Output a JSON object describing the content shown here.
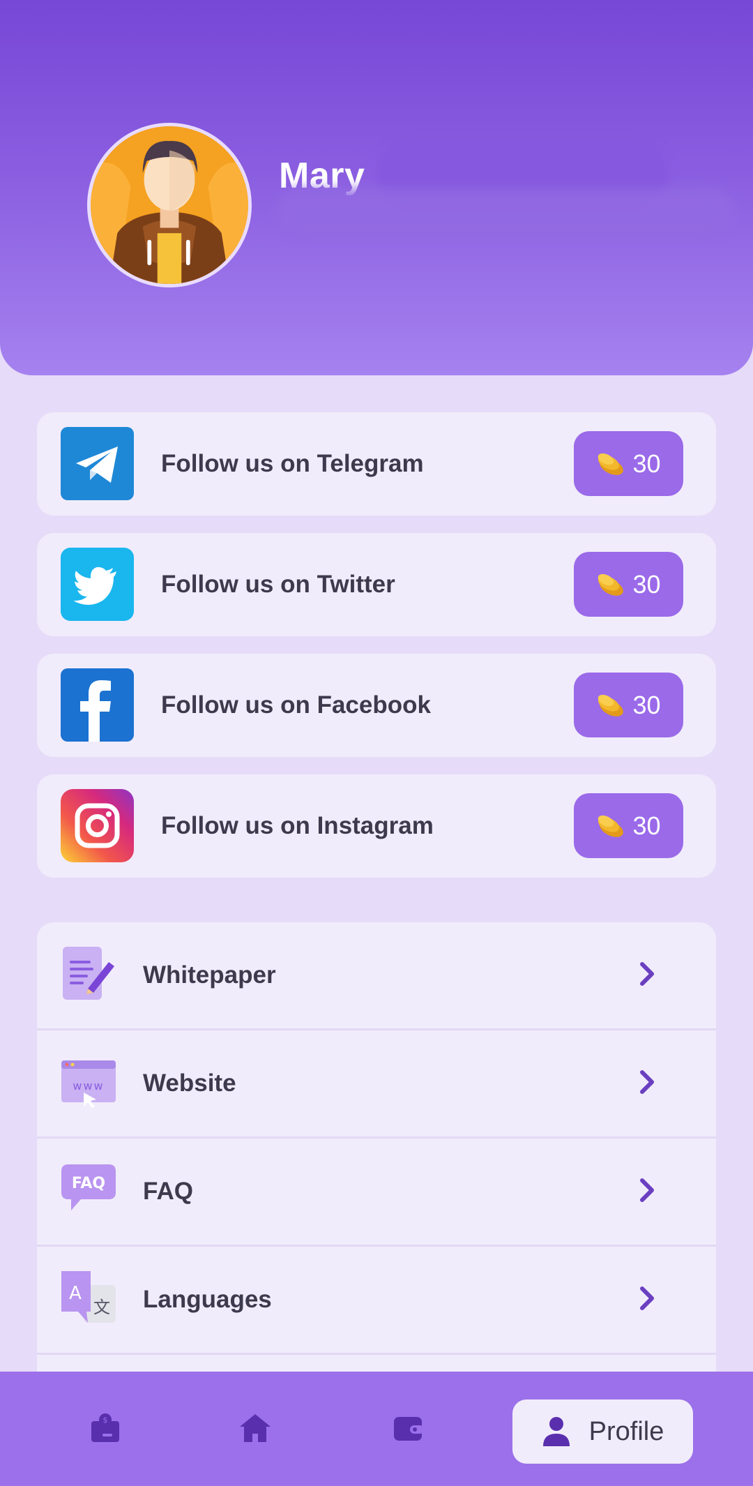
{
  "colors": {
    "header_top": "#7747d6",
    "header_bottom": "#a582ef",
    "page_bg": "#e6dbf8",
    "card_bg": "#f1ecfb",
    "reward_bg": "#9a6ae9",
    "accent": "#6a3fc0",
    "text_dark": "#3d3a4d"
  },
  "profile": {
    "name": "Mary",
    "avatar_icon": "man-with-hoodie-avatar"
  },
  "tasks": [
    {
      "label": "Follow us on Telegram",
      "reward": "30",
      "icon": "telegram-icon"
    },
    {
      "label": "Follow us on Twitter",
      "reward": "30",
      "icon": "twitter-icon"
    },
    {
      "label": "Follow us on Facebook",
      "reward": "30",
      "icon": "facebook-icon"
    },
    {
      "label": "Follow us on Instagram",
      "reward": "30",
      "icon": "instagram-icon"
    }
  ],
  "menu": [
    {
      "label": "Whitepaper",
      "icon": "document-pen-icon"
    },
    {
      "label": "Website",
      "icon": "browser-www-icon"
    },
    {
      "label": "FAQ",
      "icon": "faq-bubble-icon"
    },
    {
      "label": "Languages",
      "icon": "translate-icon"
    }
  ],
  "nav": {
    "items": [
      {
        "icon": "wallet-dollar-icon"
      },
      {
        "icon": "home-icon"
      },
      {
        "icon": "wallet-icon"
      },
      {
        "icon": "profile-icon",
        "label": "Profile",
        "active": true
      }
    ]
  }
}
